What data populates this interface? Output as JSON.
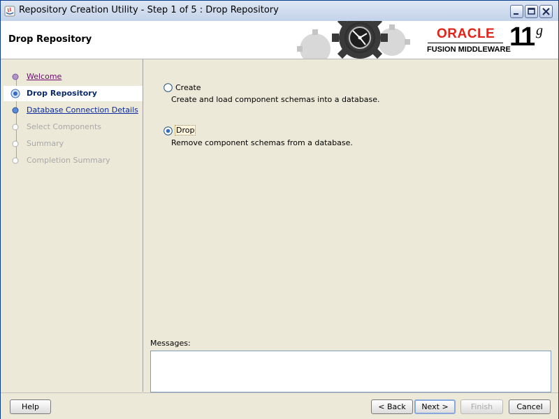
{
  "window": {
    "title": "Repository Creation Utility - Step 1 of 5 : Drop Repository"
  },
  "header": {
    "page_title": "Drop Repository",
    "brand_name": "ORACLE",
    "brand_sub": "FUSION MIDDLEWARE",
    "version": "11",
    "version_suffix": "g"
  },
  "nav": {
    "items": [
      {
        "label": "Welcome",
        "state": "visited"
      },
      {
        "label": "Drop Repository",
        "state": "current"
      },
      {
        "label": "Database Connection Details",
        "state": "link"
      },
      {
        "label": "Select Components",
        "state": "disabled"
      },
      {
        "label": "Summary",
        "state": "disabled"
      },
      {
        "label": "Completion Summary",
        "state": "disabled"
      }
    ]
  },
  "options": {
    "create": {
      "label": "Create",
      "description": "Create and load component schemas into a database.",
      "selected": false
    },
    "drop": {
      "label": "Drop",
      "description": "Remove component schemas from a database.",
      "selected": true
    }
  },
  "messages": {
    "label": "Messages:",
    "content": ""
  },
  "buttons": {
    "help": "Help",
    "back": "< Back",
    "next": "Next >",
    "finish": "Finish",
    "cancel": "Cancel"
  },
  "colors": {
    "brand_red": "#e2231a",
    "link_blue": "#0b2a9b",
    "visited_purple": "#6d0a6d"
  }
}
